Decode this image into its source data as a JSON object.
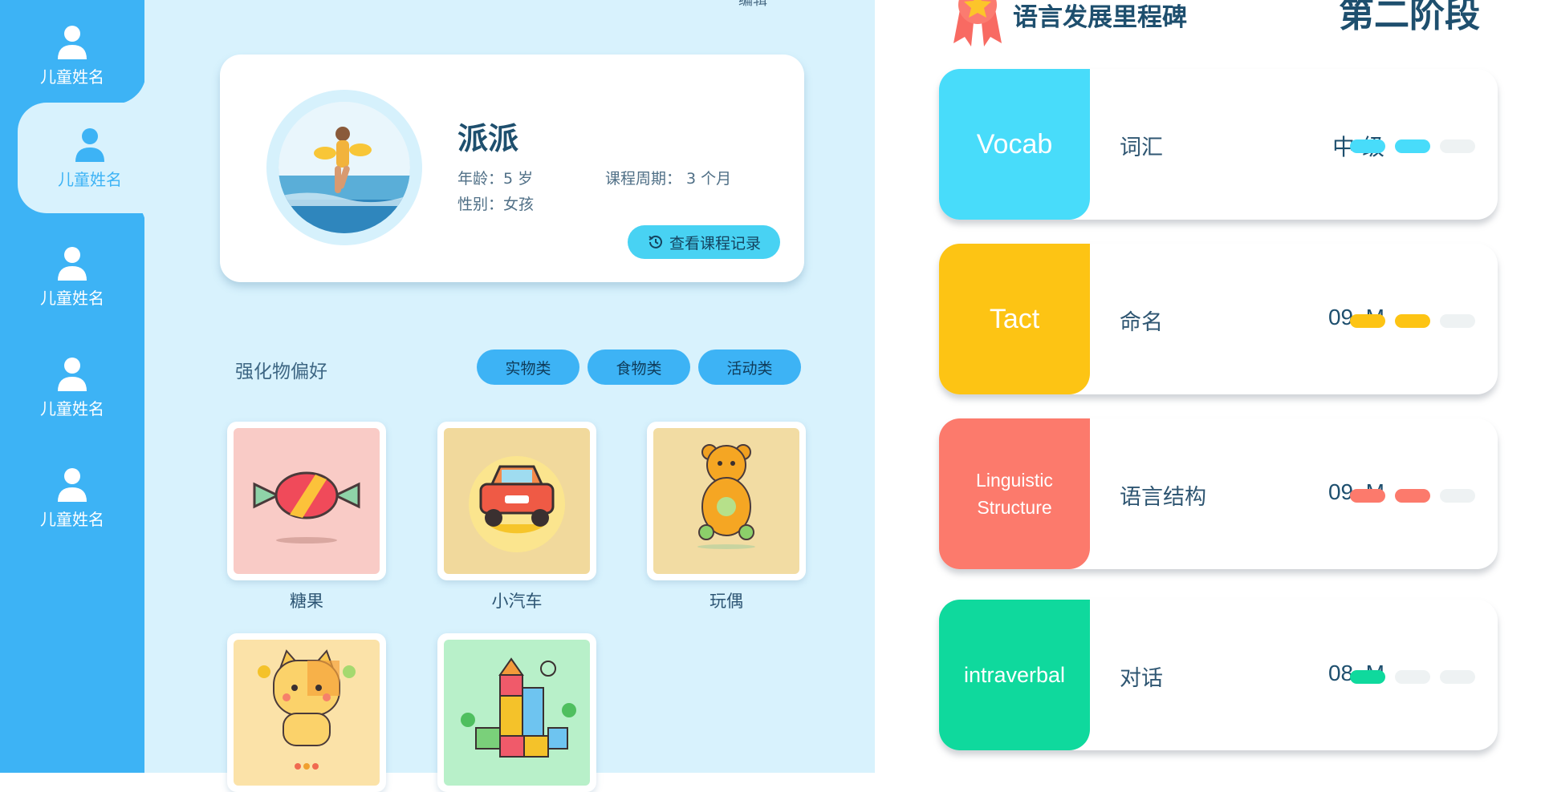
{
  "sidebar": {
    "items": [
      {
        "label": "儿童姓名"
      },
      {
        "label": "儿童姓名"
      },
      {
        "label": "儿童姓名"
      },
      {
        "label": "儿童姓名"
      },
      {
        "label": "儿童姓名"
      }
    ],
    "active_index": 1
  },
  "top_link": "编辑",
  "profile": {
    "name": "派派",
    "age": "年龄：5 岁",
    "gender": "性别：女孩",
    "course_period": "课程周期： 3 个月",
    "history_button": "查看课程记录"
  },
  "preferences": {
    "title": "强化物偏好",
    "tabs": [
      "实物类",
      "食物类",
      "活动类"
    ],
    "items": [
      {
        "label": "糖果",
        "icon": "candy-icon",
        "bg": "#f9cbc6"
      },
      {
        "label": "小汽车",
        "icon": "toy-car-icon",
        "bg": "#f1d99c"
      },
      {
        "label": "玩偶",
        "icon": "teddy-bear-icon",
        "bg": "#f2dca3"
      },
      {
        "label": "",
        "icon": "cat-toy-icon",
        "bg": "#fbe2a8"
      },
      {
        "label": "",
        "icon": "building-blocks-icon",
        "bg": "#b8f0c9"
      }
    ]
  },
  "milestones": {
    "title": "语言发展里程碑",
    "stage": "第二阶段",
    "items": [
      {
        "tag": "Vocab",
        "name": "词汇",
        "level": "中 级",
        "color": "#48dcfa",
        "filled": 2,
        "total": 3
      },
      {
        "tag": "Tact",
        "name": "命名",
        "level": "09–M",
        "color": "#fdc414",
        "filled": 2,
        "total": 3
      },
      {
        "tag": "Linguistic Structure",
        "name": "语言结构",
        "level": "09–M",
        "color": "#fc7a6c",
        "filled": 2,
        "total": 3
      },
      {
        "tag": "intraverbal",
        "name": "对话",
        "level": "08–M",
        "color": "#0fd99d",
        "filled": 1,
        "total": 3
      }
    ]
  }
}
